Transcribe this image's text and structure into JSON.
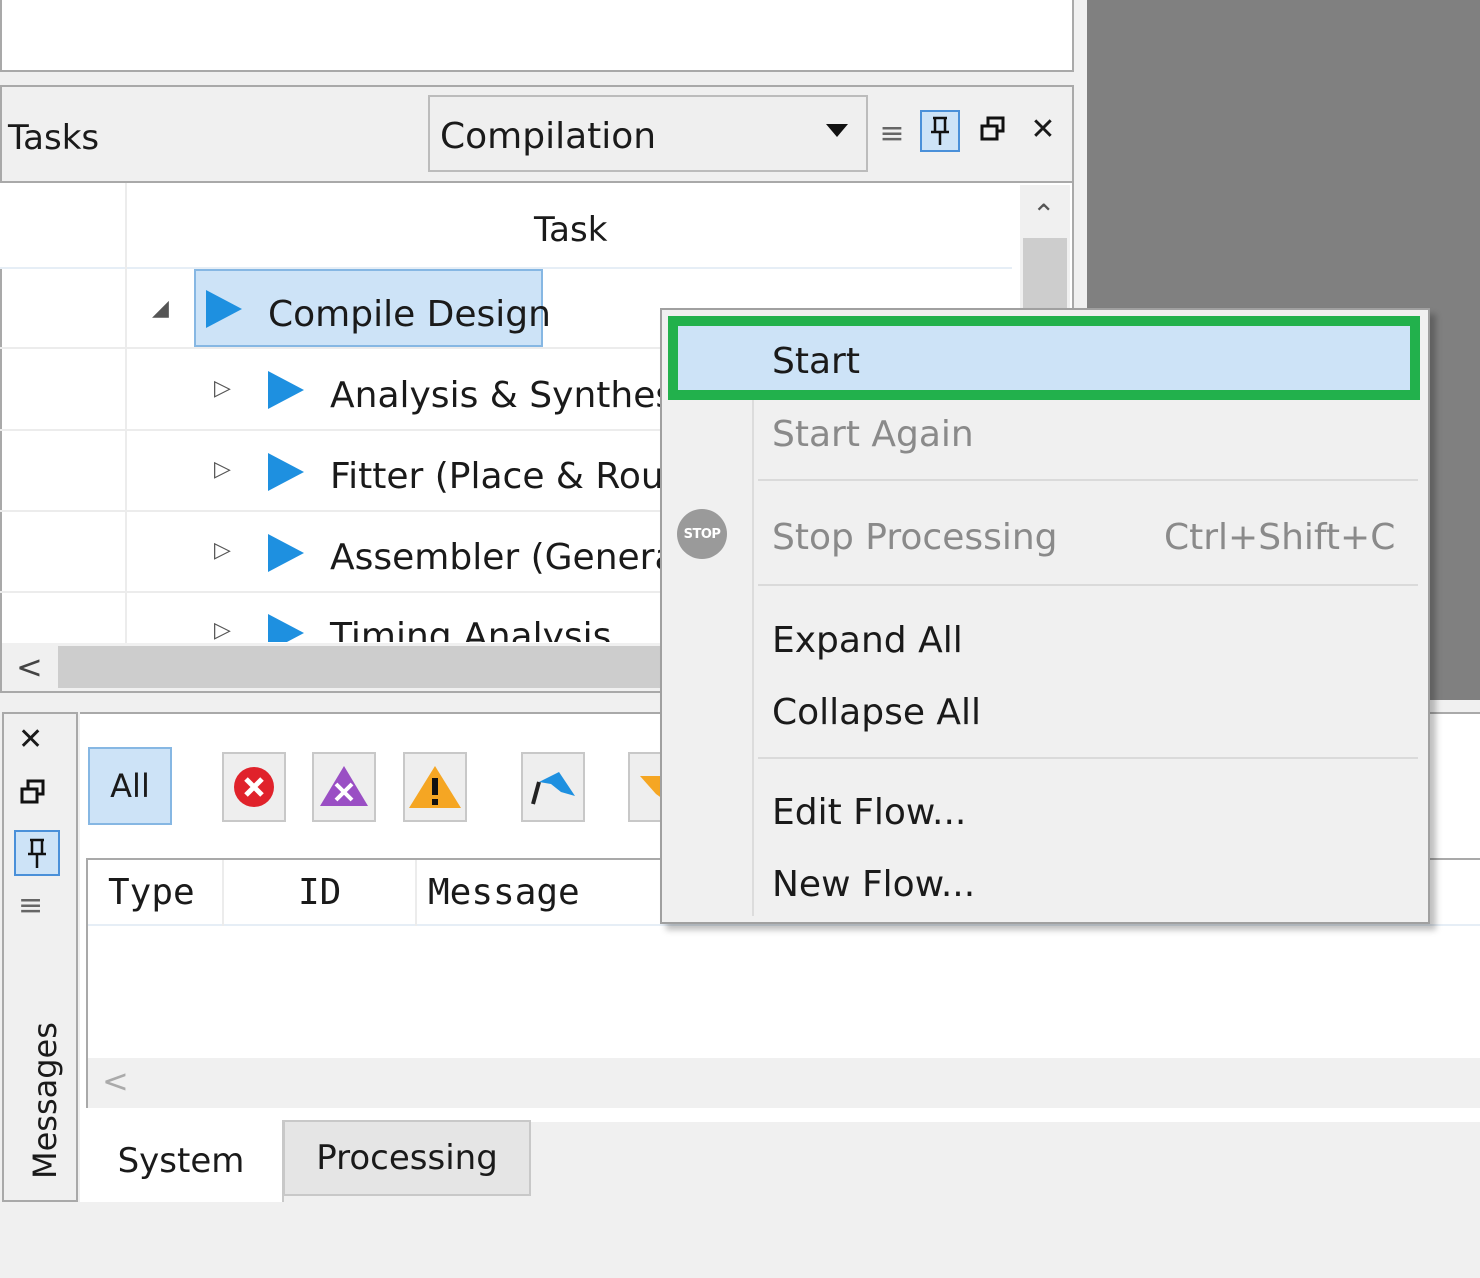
{
  "tasks_panel": {
    "title": "Tasks",
    "flow_select_value": "Compilation",
    "column_task": "Task",
    "rows": [
      {
        "label": "Compile Design"
      },
      {
        "label": "Analysis & Synthesi"
      },
      {
        "label": "Fitter (Place & Route"
      },
      {
        "label": "Assembler (Generat"
      },
      {
        "label": "Timing Analysis"
      }
    ]
  },
  "context_menu": {
    "start": "Start",
    "start_again": "Start Again",
    "stop_processing": "Stop Processing",
    "stop_shortcut": "Ctrl+Shift+C",
    "stop_icon_text": "STOP",
    "expand_all": "Expand All",
    "collapse_all": "Collapse All",
    "edit_flow": "Edit Flow...",
    "new_flow": "New Flow..."
  },
  "messages_panel": {
    "side_title": "Messages",
    "filter_all": "All",
    "columns": [
      "Type",
      "ID",
      "Message"
    ],
    "tabs": [
      "System",
      "Processing"
    ]
  },
  "colors": {
    "highlight_border": "#22b14c",
    "selection_bg": "#cde3f7",
    "play_icon": "#1e90e0"
  }
}
